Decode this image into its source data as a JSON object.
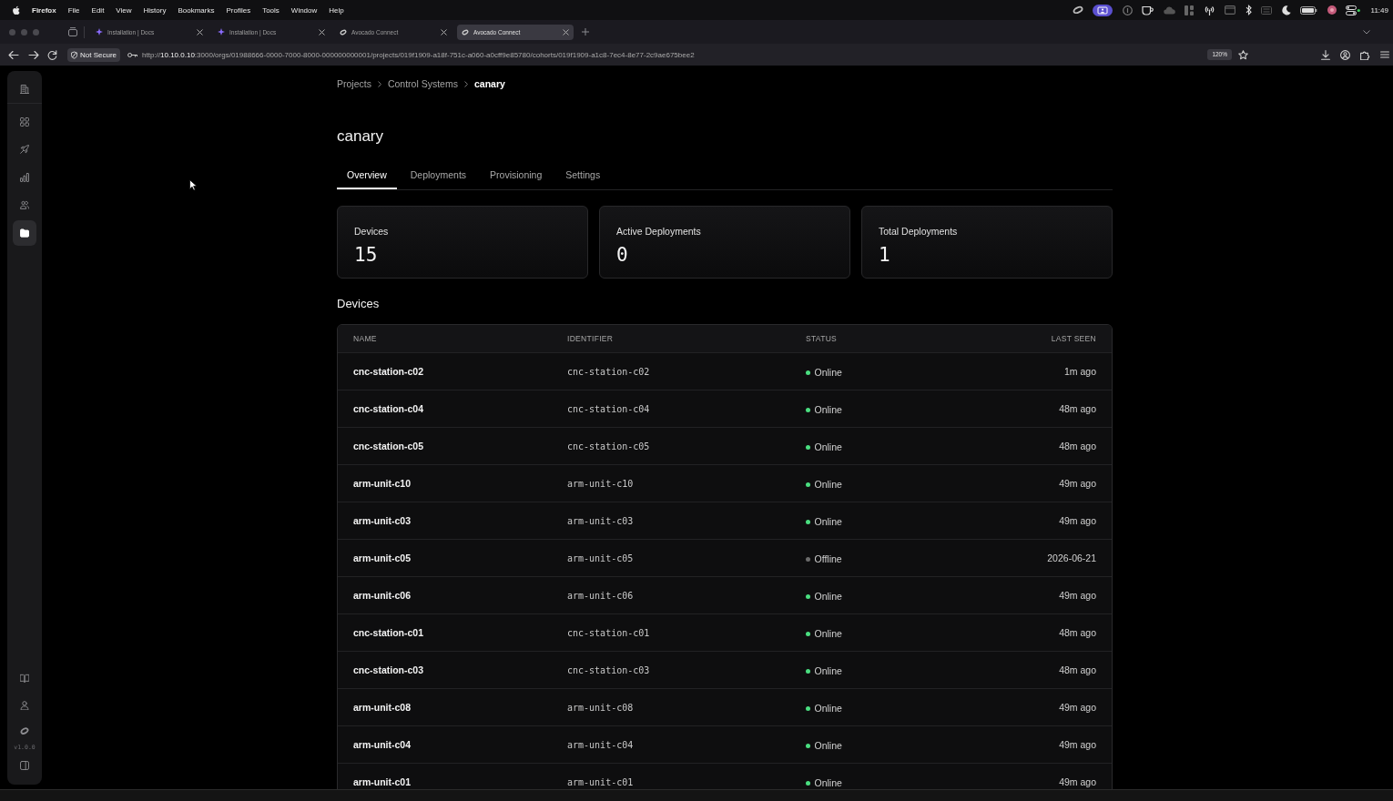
{
  "menu_bar": {
    "app_name": "Firefox",
    "menus": [
      "File",
      "Edit",
      "View",
      "History",
      "Bookmarks",
      "Profiles",
      "Tools",
      "Window",
      "Help"
    ],
    "clock": "11:49"
  },
  "browser": {
    "tabs": [
      {
        "title": "Installation | Docs",
        "kind": "docs",
        "selected": false
      },
      {
        "title": "Installation | Docs",
        "kind": "docs",
        "selected": false
      },
      {
        "title": "Avocado Connect",
        "kind": "app",
        "selected": false
      },
      {
        "title": "Avocado Connect",
        "kind": "app",
        "selected": true
      }
    ],
    "security_label": "Not Secure",
    "url": "http://**10.10.0.10**:3000/orgs/01988666-0000-7000-8000-000000000001/projects/019f1909-a18f-751c-a060-a0cff9e85780/cohorts/019f1909-a1c8-7ec4-8e77-2c9ae675bee2",
    "zoom": "120%"
  },
  "sidebar": {
    "header": {
      "kind": "building"
    },
    "items": [
      {
        "kind": "grid",
        "selected": false
      },
      {
        "kind": "rocket",
        "selected": false
      },
      {
        "kind": "chart",
        "selected": false
      },
      {
        "kind": "users",
        "selected": false
      },
      {
        "kind": "folder",
        "selected": true
      }
    ],
    "footer_items": [
      {
        "kind": "book"
      },
      {
        "kind": "user"
      },
      {
        "kind": "logo",
        "version": "v1.0.0"
      },
      {
        "kind": "panel"
      }
    ]
  },
  "breadcrumb": [
    {
      "label": "Projects",
      "current": false
    },
    {
      "label": "Control Systems",
      "current": false
    },
    {
      "label": "canary",
      "current": true
    }
  ],
  "title": "canary",
  "tabs": [
    {
      "label": "Overview",
      "selected": true
    },
    {
      "label": "Deployments",
      "selected": false
    },
    {
      "label": "Provisioning",
      "selected": false
    },
    {
      "label": "Settings",
      "selected": false
    }
  ],
  "stats": [
    {
      "label": "Devices",
      "value": "15"
    },
    {
      "label": "Active Deployments",
      "value": "0"
    },
    {
      "label": "Total Deployments",
      "value": "1"
    }
  ],
  "devices": {
    "title": "Devices",
    "columns": [
      "NAME",
      "IDENTIFIER",
      "STATUS",
      "LAST SEEN"
    ],
    "rows": [
      {
        "name": "cnc-station-c02",
        "identifier": "cnc-station-c02",
        "status": "Online",
        "color": "#4ade80",
        "last_seen": "1m ago"
      },
      {
        "name": "cnc-station-c04",
        "identifier": "cnc-station-c04",
        "status": "Online",
        "color": "#4ade80",
        "last_seen": "48m ago"
      },
      {
        "name": "cnc-station-c05",
        "identifier": "cnc-station-c05",
        "status": "Online",
        "color": "#4ade80",
        "last_seen": "48m ago"
      },
      {
        "name": "arm-unit-c10",
        "identifier": "arm-unit-c10",
        "status": "Online",
        "color": "#4ade80",
        "last_seen": "49m ago"
      },
      {
        "name": "arm-unit-c03",
        "identifier": "arm-unit-c03",
        "status": "Online",
        "color": "#4ade80",
        "last_seen": "49m ago"
      },
      {
        "name": "arm-unit-c05",
        "identifier": "arm-unit-c05",
        "status": "Offline",
        "color": "#6b6b6b",
        "last_seen": "2026-06-21"
      },
      {
        "name": "arm-unit-c06",
        "identifier": "arm-unit-c06",
        "status": "Online",
        "color": "#4ade80",
        "last_seen": "49m ago"
      },
      {
        "name": "cnc-station-c01",
        "identifier": "cnc-station-c01",
        "status": "Online",
        "color": "#4ade80",
        "last_seen": "48m ago"
      },
      {
        "name": "cnc-station-c03",
        "identifier": "cnc-station-c03",
        "status": "Online",
        "color": "#4ade80",
        "last_seen": "48m ago"
      },
      {
        "name": "arm-unit-c08",
        "identifier": "arm-unit-c08",
        "status": "Online",
        "color": "#4ade80",
        "last_seen": "49m ago"
      },
      {
        "name": "arm-unit-c04",
        "identifier": "arm-unit-c04",
        "status": "Online",
        "color": "#4ade80",
        "last_seen": "49m ago"
      },
      {
        "name": "arm-unit-c01",
        "identifier": "arm-unit-c01",
        "status": "Online",
        "color": "#4ade80",
        "last_seen": "49m ago"
      }
    ]
  }
}
